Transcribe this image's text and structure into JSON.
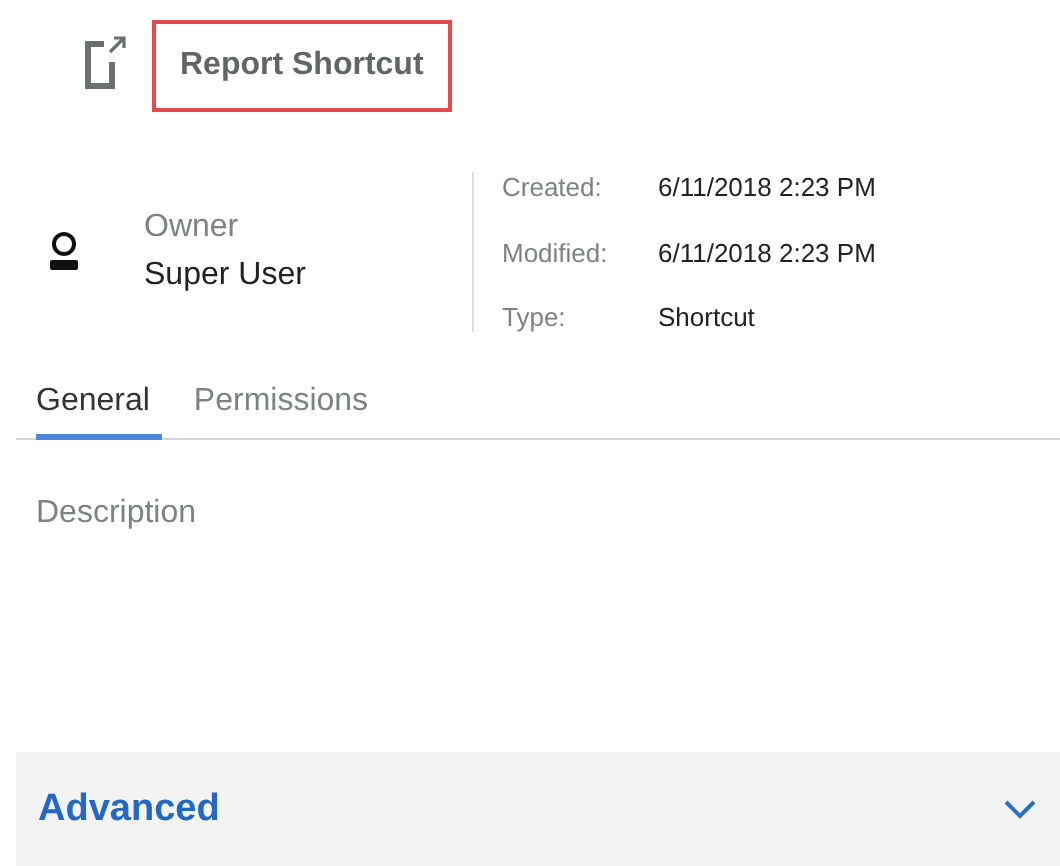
{
  "header": {
    "title": "Report Shortcut",
    "highlighted": true
  },
  "owner": {
    "label": "Owner",
    "name": "Super User"
  },
  "properties": [
    {
      "label": "Created:",
      "value": "6/11/2018 2:23 PM"
    },
    {
      "label": "Modified:",
      "value": "6/11/2018 2:23 PM"
    },
    {
      "label": "Type:",
      "value": "Shortcut"
    }
  ],
  "tabs": [
    {
      "label": "General",
      "selected": true
    },
    {
      "label": "Permissions",
      "selected": false
    }
  ],
  "description": {
    "placeholder": "Description"
  },
  "advanced": {
    "label": "Advanced",
    "expanded": false
  }
}
